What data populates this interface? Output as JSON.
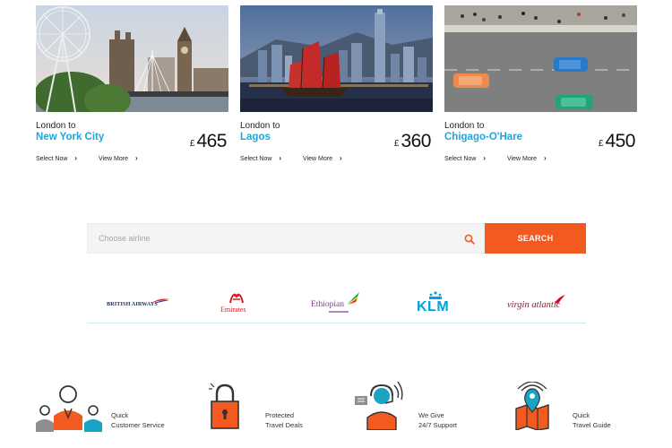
{
  "deals": [
    {
      "origin": "London to",
      "destination": "New York City",
      "currency": "£",
      "price": "465",
      "select_label": "Select Now",
      "view_label": "View More",
      "image": "london-skyline-photo"
    },
    {
      "origin": "London to",
      "destination": "Lagos",
      "currency": "£",
      "price": "360",
      "select_label": "Select Now",
      "view_label": "View More",
      "image": "hong-kong-junk-boat-photo"
    },
    {
      "origin": "London to",
      "destination": "Chigago-O'Hare",
      "currency": "£",
      "price": "450",
      "select_label": "Select Now",
      "view_label": "View More",
      "image": "aerial-road-cars-photo"
    }
  ],
  "search": {
    "placeholder": "Choose airline",
    "button_label": "SEARCH"
  },
  "airlines": [
    {
      "name": "BRITISH AIRWAYS",
      "icon": "speedmarque"
    },
    {
      "name": "Emirates",
      "icon": "emirates-calligraphy"
    },
    {
      "name": "Ethiopian",
      "icon": "ethiopian-tricolor-tail"
    },
    {
      "name": "KLM",
      "icon": "klm-crown"
    },
    {
      "name": "virgin atlantic",
      "icon": "virgin-flying-lady"
    }
  ],
  "features": [
    {
      "line1": "Quick",
      "line2": "Customer Service",
      "icon": "customer-service-people-icon"
    },
    {
      "line1": "Protected",
      "line2": "Travel Deals",
      "icon": "padlock-icon"
    },
    {
      "line1": "We Give",
      "line2": "24/7 Support",
      "icon": "support-agent-headset-icon"
    },
    {
      "line1": "Quick",
      "line2": "Travel Guide",
      "icon": "map-pin-icon"
    }
  ],
  "colors": {
    "accent_orange": "#f25a1f",
    "link_blue": "#1ea6d8",
    "icon_teal": "#19a3c4"
  }
}
